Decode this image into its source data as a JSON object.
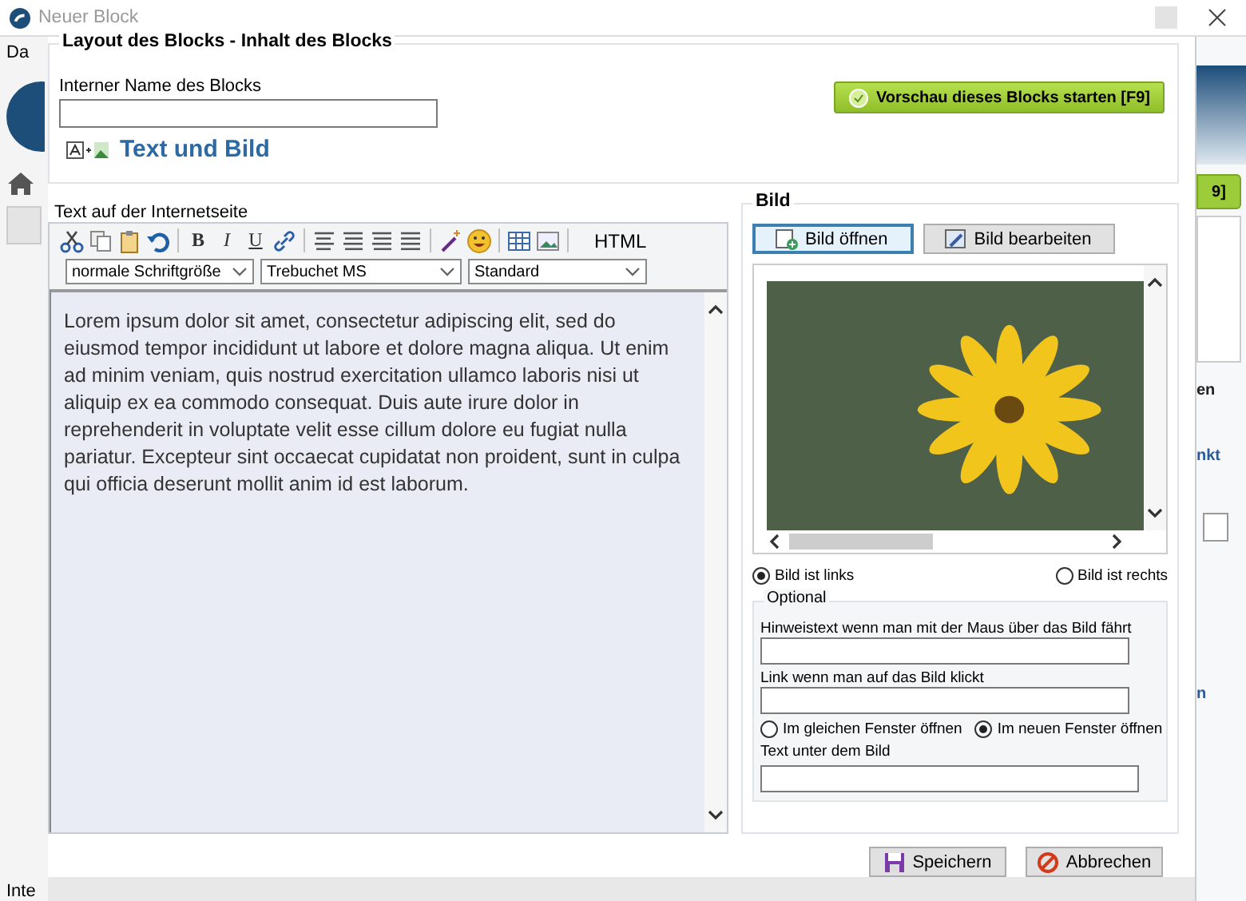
{
  "window": {
    "title": "Neuer Block"
  },
  "background_app": {
    "left_texts": [
      "Da",
      "Inte"
    ],
    "right_button": "9]",
    "right_texts": [
      "en",
      "nkt",
      "n"
    ]
  },
  "layout_group": {
    "title": "Layout des Blocks - Inhalt des Blocks",
    "name_label": "Interner Name des Blocks",
    "block_type": "Text und Bild",
    "preview_button": "Vorschau dieses Blocks starten [F9]"
  },
  "editor": {
    "title": "Text auf der Internetseite",
    "format_buttons": [
      "B",
      "I",
      "U"
    ],
    "html_button": "HTML",
    "dropdowns": [
      "normale Schriftgröße",
      "Trebuchet MS",
      "Standard"
    ],
    "text": "Lorem ipsum dolor sit amet, consectetur adipiscing elit, sed do eiusmod tempor incididunt ut labore et dolore magna aliqua. Ut enim ad minim veniam, quis nostrud exercitation ullamco laboris nisi ut aliquip ex ea commodo consequat. Duis aute irure dolor in reprehenderit in voluptate velit esse cillum dolore eu fugiat nulla pariatur. Excepteur sint occaecat cupidatat non proident, sunt in culpa qui officia deserunt mollit anim id est laborum."
  },
  "image_panel": {
    "title": "Bild",
    "buttons": [
      "Bild öffnen",
      "Bild bearbeiten"
    ],
    "position": [
      {
        "label": "Bild ist links",
        "selected": true
      },
      {
        "label": "Bild ist rechts",
        "selected": false
      }
    ],
    "optional": {
      "title": "Optional",
      "hover_label": "Hinweistext wenn man mit der Maus über das Bild fährt",
      "link_label": "Link wenn man auf das Bild klickt",
      "target": [
        {
          "label": "Im gleichen Fenster öffnen",
          "selected": false
        },
        {
          "label": "Im neuen Fenster öffnen",
          "selected": true
        }
      ],
      "caption_label": "Text unter dem Bild"
    }
  },
  "buttons": [
    "Speichern",
    "Abbrechen"
  ]
}
